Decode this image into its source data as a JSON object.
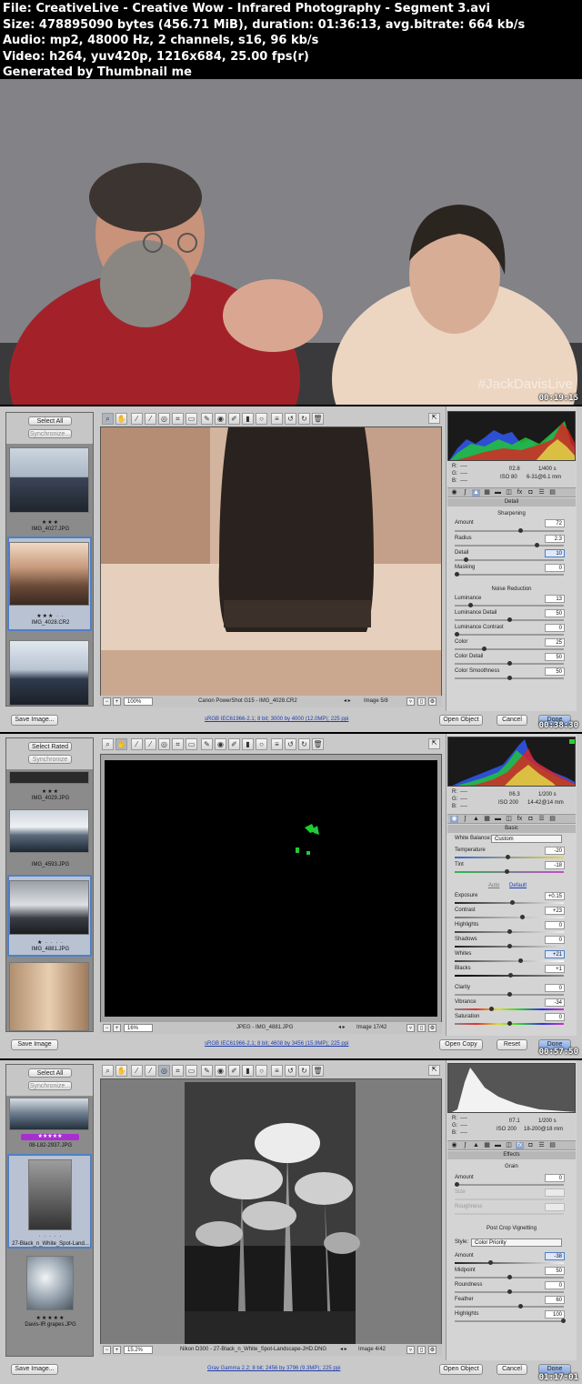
{
  "header": {
    "line1": "File: CreativeLive - Creative Wow - Infrared Photography - Segment 3.avi",
    "line2": "Size: 478895090 bytes (456.71 MiB), duration: 01:36:13, avg.bitrate: 664 kb/s",
    "line3": "Audio: mp2, 48000 Hz, 2 channels, s16, 96 kb/s",
    "line4": "Video: h264, yuv420p, 1216x684, 25.00 fps(r)",
    "line5": "Generated by Thumbnail me"
  },
  "frame1": {
    "watermark": "#JackDavisLive",
    "timestamp": "00:19:15"
  },
  "frame2": {
    "timestamp": "00:38:30",
    "select_all": "Select All",
    "synchronize": "Synchronize...",
    "thumbs": [
      {
        "stars": "★★★",
        "caption": "IMG_4027.JPG"
      },
      {
        "stars": "★★★ · ·",
        "caption": "IMG_4028.CR2"
      },
      {
        "stars": "",
        "caption": ""
      }
    ],
    "zoom": "100%",
    "camera": "Canon PowerShot G15  -  IMG_4028.CR2",
    "image_count": "Image 5/8",
    "save": "Save Image...",
    "info_link": "sRGB IEC61966-2.1; 8 bit; 3000 by 4000 (12.0MP); 225 ppi",
    "open": "Open Object",
    "cancel": "Cancel",
    "done": "Done",
    "exif": {
      "r": "R:",
      "g": "G:",
      "b": "B:",
      "r_v": "----",
      "g_v": "----",
      "b_v": "----",
      "fstop": "f/2.8",
      "shutter": "1/400 s",
      "iso": "ISO 80",
      "focal": "6-31@6.1 mm"
    },
    "panel": "Detail",
    "sharpening": "Sharpening",
    "sharp_rows": [
      {
        "label": "Amount",
        "value": "72"
      },
      {
        "label": "Radius",
        "value": "2.3"
      },
      {
        "label": "Detail",
        "value": "10"
      },
      {
        "label": "Masking",
        "value": "0"
      }
    ],
    "noise": "Noise Reduction",
    "noise_rows": [
      {
        "label": "Luminance",
        "value": "13"
      },
      {
        "label": "Luminance Detail",
        "value": "50"
      },
      {
        "label": "Luminance Contrast",
        "value": "0"
      },
      {
        "label": "Color",
        "value": "25"
      },
      {
        "label": "Color Detail",
        "value": "50"
      },
      {
        "label": "Color Smoothness",
        "value": "50"
      }
    ]
  },
  "frame3": {
    "timestamp": "00:57:50",
    "select_rated": "Select Rated",
    "synchronize": "Synchronize",
    "thumbs": [
      {
        "stars": "★★★",
        "caption": "IMG_4029.JPG"
      },
      {
        "stars": "",
        "caption": "IMG_4593.JPG"
      },
      {
        "stars": "★ · · · ·",
        "caption": "IMG_4881.JPG"
      }
    ],
    "zoom": "16%",
    "format": "JPEG  -  IMG_4881.JPG",
    "image_count": "Image 17/42",
    "save": "Save Image",
    "info_link": "sRGB IEC61966-2.1; 8 bit; 4608 by 3456 (15.9MP); 225 ppi",
    "open": "Open Copy",
    "reset": "Reset",
    "done": "Done",
    "exif": {
      "r": "R:",
      "g": "G:",
      "b": "B:",
      "r_v": "----",
      "g_v": "----",
      "b_v": "----",
      "fstop": "f/6.3",
      "shutter": "1/200 s",
      "iso": "ISO 200",
      "focal": "14-42@14 mm"
    },
    "panel": "Basic",
    "wb_label": "White Balance:",
    "wb_value": "Custom",
    "temp_rows": [
      {
        "label": "Temperature",
        "value": "-20"
      },
      {
        "label": "Tint",
        "value": "-18"
      }
    ],
    "auto": "Auto",
    "default": "Default",
    "tone_rows": [
      {
        "label": "Exposure",
        "value": "+0.15"
      },
      {
        "label": "Contrast",
        "value": "+23"
      },
      {
        "label": "Highlights",
        "value": "0"
      },
      {
        "label": "Shadows",
        "value": "0"
      },
      {
        "label": "Whites",
        "value": "+21"
      },
      {
        "label": "Blacks",
        "value": "+1"
      }
    ],
    "presence_rows": [
      {
        "label": "Clarity",
        "value": "0"
      },
      {
        "label": "Vibrance",
        "value": "-34"
      },
      {
        "label": "Saturation",
        "value": "0"
      }
    ]
  },
  "frame4": {
    "timestamp": "01:17:01",
    "select_all": "Select All",
    "synchronize": "Synchronize...",
    "thumbs": [
      {
        "stars": "★★★★★",
        "caption": "08-L82-2937.JPG"
      },
      {
        "stars": "· · · · ·",
        "caption": "27-Black_n_White_Spot-Land..."
      },
      {
        "stars": "★★★★★",
        "caption": "Davis-IR grapes.JPG"
      }
    ],
    "zoom": "15.2%",
    "camera": "Nikon D300  -  27-Black_n_White_Spot-Landscape-JHD.DNG",
    "image_count": "Image 4/42",
    "save": "Save Image...",
    "info_link": "Gray Gamma 2.2; 8 bit; 2456 by 3796 (9.3MP); 225 ppi",
    "open": "Open Object",
    "cancel": "Cancel",
    "done": "Done",
    "exif": {
      "r": "R:",
      "g": "G:",
      "b": "B:",
      "r_v": "----",
      "g_v": "----",
      "b_v": "----",
      "fstop": "f/7.1",
      "shutter": "1/200 s",
      "iso": "ISO 200",
      "focal": "18-200@18 mm"
    },
    "panel": "Effects",
    "grain": "Grain",
    "grain_rows": [
      {
        "label": "Amount",
        "value": "0"
      },
      {
        "label": "Size",
        "value": ""
      },
      {
        "label": "Roughness",
        "value": ""
      }
    ],
    "vignette": "Post Crop Vignetting",
    "style_label": "Style:",
    "style_value": "Color Priority",
    "vig_rows": [
      {
        "label": "Amount",
        "value": "-38"
      },
      {
        "label": "Midpoint",
        "value": "50"
      },
      {
        "label": "Roundness",
        "value": "0"
      },
      {
        "label": "Feather",
        "value": "60"
      },
      {
        "label": "Highlights",
        "value": "100"
      }
    ]
  }
}
